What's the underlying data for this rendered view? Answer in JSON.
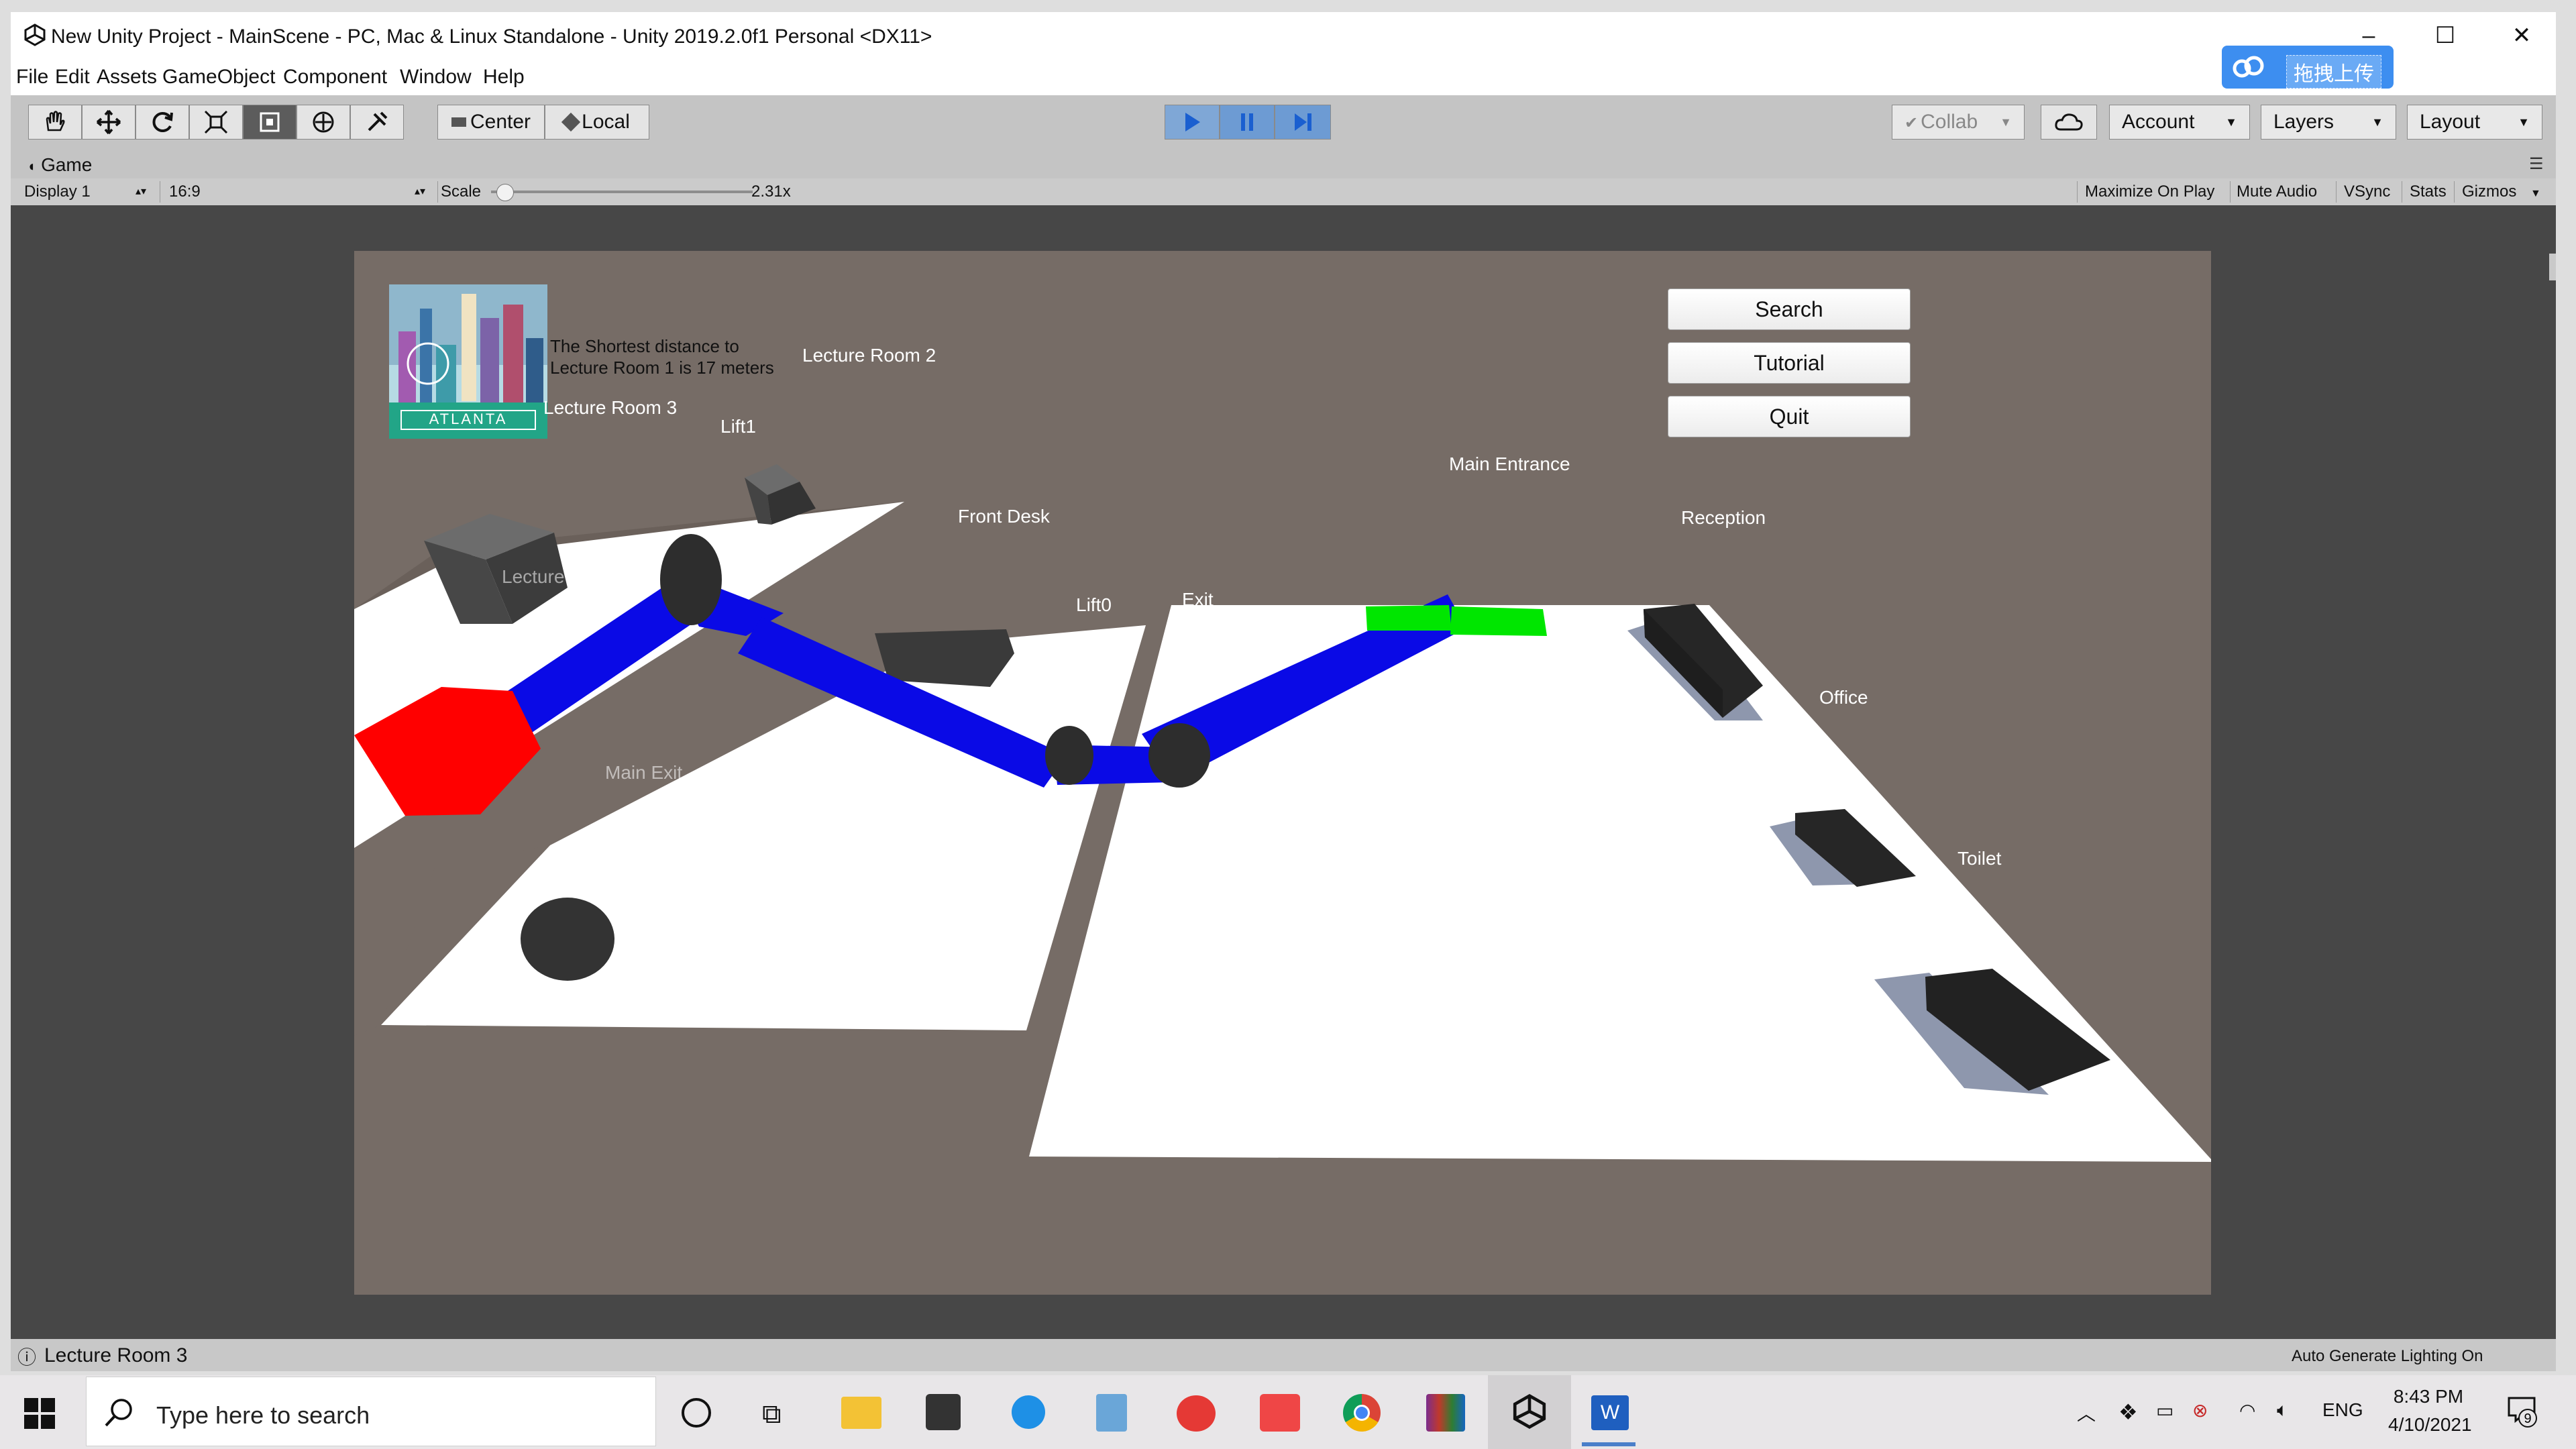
{
  "window": {
    "title": "New Unity Project - MainScene - PC, Mac & Linux Standalone - Unity 2019.2.0f1 Personal <DX11>",
    "minimize": "–",
    "maximize": "☐",
    "close": "✕"
  },
  "menu": [
    "File",
    "Edit",
    "Assets",
    "GameObject",
    "Component",
    "Window",
    "Help"
  ],
  "upload_button": "拖拽上传",
  "toolbar": {
    "pivot_label": "Center",
    "rotation_label": "Local",
    "collab_label": "Collab",
    "account_label": "Account",
    "layers_label": "Layers",
    "layout_label": "Layout"
  },
  "game_view": {
    "tab_label": "Game",
    "display_label": "Display 1",
    "aspect_label": "16:9",
    "scale_label": "Scale",
    "scale_value": "2.31x",
    "scale_fraction": 0.05,
    "maximize_on_play": "Maximize On Play",
    "mute_audio": "Mute Audio",
    "vsync": "VSync",
    "stats": "Stats",
    "gizmos": "Gizmos"
  },
  "scene": {
    "info_line1": "The Shortest distance to",
    "info_line2": "Lecture Room 1 is 17 meters",
    "logo_text": "ATLANTA",
    "buttons": {
      "search": "Search",
      "tutorial": "Tutorial",
      "quit": "Quit"
    },
    "labels": {
      "lecture_room_2": "Lecture Room 2",
      "lecture_room_3": "Lecture Room 3",
      "lift1": "Lift1",
      "main_entrance": "Main Entrance",
      "front_desk": "Front Desk",
      "reception": "Reception",
      "lecture_room_1": "Lecture Room 1",
      "lift0": "Lift0",
      "exit": "Exit",
      "office": "Office",
      "main_exit": "Main Exit",
      "toilet": "Toilet"
    },
    "colors": {
      "path": "#0a0ae6",
      "start": "#ff0000",
      "goal": "#00e600",
      "background": "#766c66"
    }
  },
  "status": {
    "message": "Lecture Room 3",
    "lighting": "Auto Generate Lighting On"
  },
  "taskbar": {
    "search_placeholder": "Type here to search",
    "language": "ENG",
    "time": "8:43 PM",
    "date": "4/10/2021",
    "notification_count": "9"
  }
}
